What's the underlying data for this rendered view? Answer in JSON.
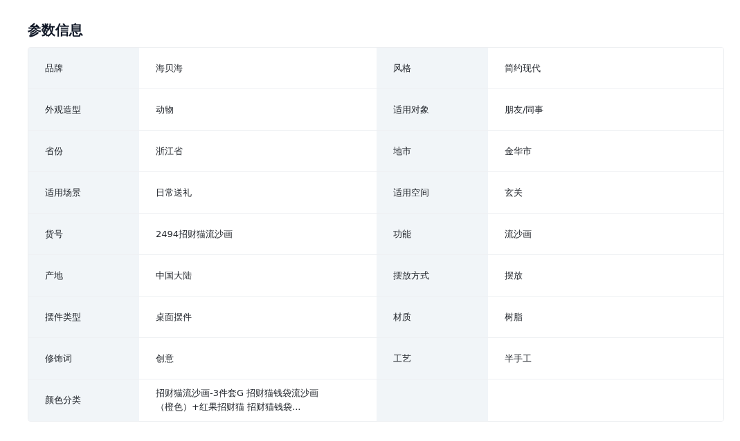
{
  "title": "参数信息",
  "params": [
    {
      "label": "品牌",
      "value": "海贝海"
    },
    {
      "label": "风格",
      "value": "简约现代"
    },
    {
      "label": "外观造型",
      "value": "动物"
    },
    {
      "label": "适用对象",
      "value": "朋友/同事"
    },
    {
      "label": "省份",
      "value": "浙江省"
    },
    {
      "label": "地市",
      "value": "金华市"
    },
    {
      "label": "适用场景",
      "value": "日常送礼"
    },
    {
      "label": "适用空间",
      "value": "玄关"
    },
    {
      "label": "货号",
      "value": "2494招财猫流沙画"
    },
    {
      "label": "功能",
      "value": "流沙画"
    },
    {
      "label": "产地",
      "value": "中国大陆"
    },
    {
      "label": "摆放方式",
      "value": "摆放"
    },
    {
      "label": "摆件类型",
      "value": "桌面摆件"
    },
    {
      "label": "材质",
      "value": "树脂"
    },
    {
      "label": "修饰词",
      "value": "创意"
    },
    {
      "label": "工艺",
      "value": "半手工"
    },
    {
      "label": "颜色分类",
      "value": "招财猫流沙画-3件套G 招财猫钱袋流沙画（橙色）+红果招财猫 招财猫钱袋..."
    }
  ]
}
